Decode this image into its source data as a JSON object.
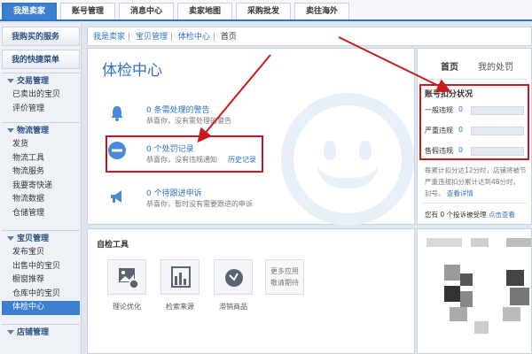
{
  "topnav": {
    "tabs": [
      {
        "label": "我是卖家",
        "active": true
      },
      {
        "label": "账号管理",
        "active": false
      },
      {
        "label": "消息中心",
        "active": false
      },
      {
        "label": "卖家地图",
        "active": false
      },
      {
        "label": "采购批发",
        "active": false
      },
      {
        "label": "卖往海外",
        "active": false
      }
    ]
  },
  "sidebar": {
    "block1": "我购买的服务",
    "block2": "我的快捷菜单",
    "groups": [
      {
        "title": "交易管理",
        "items": [
          "已卖出的宝贝",
          "评价管理"
        ]
      },
      {
        "title": "物流管理",
        "items": [
          "发货",
          "物流工具",
          "物流服务",
          "我要寄快递",
          "物流数据",
          "仓储管理"
        ]
      },
      {
        "title": "宝贝管理",
        "items": [
          "发布宝贝",
          "出售中的宝贝",
          "橱窗推荐",
          "仓库中的宝贝",
          "体检中心"
        ]
      },
      {
        "title": "店铺管理",
        "items": []
      }
    ],
    "active_item": "体检中心"
  },
  "breadcrumb": [
    "我是卖家",
    "宝贝管理",
    "体检中心",
    "首页"
  ],
  "main": {
    "title": "体检中心",
    "notices": [
      {
        "title": "0 条需处理的警告",
        "desc": "恭喜你，没有需处理的警告",
        "icon": "bell-icon"
      },
      {
        "title": "0 个处罚记录",
        "desc": "恭喜你，没有违规通知",
        "link": "历史记录",
        "icon": "minus-circle-icon"
      },
      {
        "title": "0 个待跟进申诉",
        "desc": "恭喜你，暂时没有需要跟进的申诉",
        "icon": "megaphone-icon"
      }
    ]
  },
  "right_panel": {
    "tabs": [
      "首页",
      "我的处罚"
    ],
    "score_title": "账号扣分状况",
    "rows": [
      {
        "label": "一般违规",
        "value": "0"
      },
      {
        "label": "严重违规",
        "value": "0"
      },
      {
        "label": "售假违规",
        "value": "0"
      }
    ],
    "note1": "每累计扣分达12分时，店铺将被节",
    "note2": "严重违规扣分累计达到48分时，",
    "note3": "封号。",
    "note_link": "查看详情",
    "appeal_text": "您有 0 个投诉被受理",
    "appeal_link": "点击查看"
  },
  "tools": {
    "title": "自检工具",
    "items": [
      {
        "label": "理论优化",
        "icon": "image-check-icon"
      },
      {
        "label": "检索来源",
        "icon": "bar-chart-icon"
      },
      {
        "label": "滞销商品",
        "icon": "gauge-icon"
      }
    ],
    "more": [
      "更多应用",
      "敬请期待"
    ]
  },
  "colors": {
    "accent": "#3c7fd1",
    "link": "#2f72c4",
    "highlight": "#c8191d"
  }
}
